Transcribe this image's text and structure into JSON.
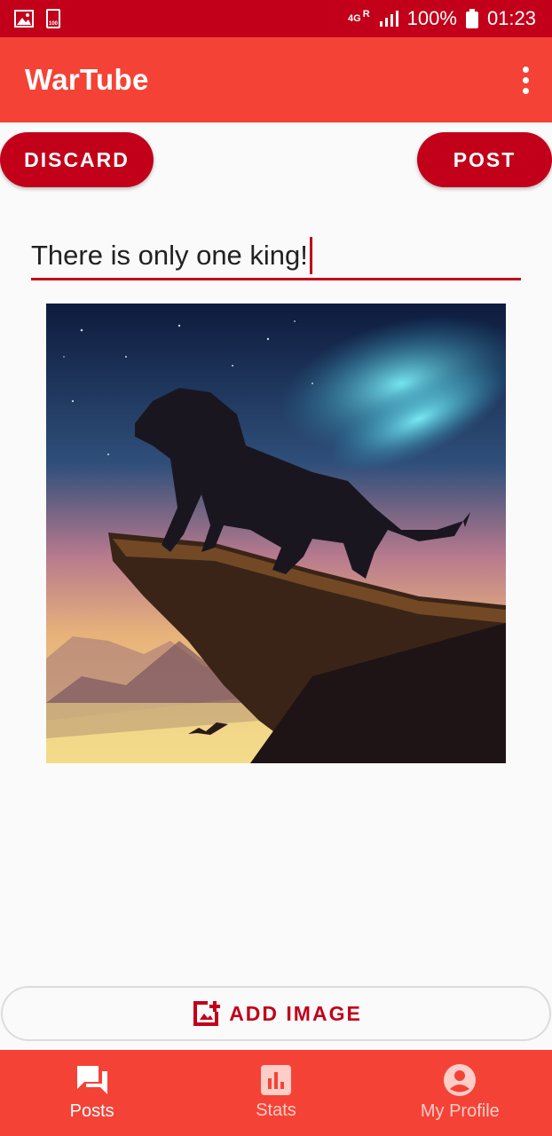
{
  "status_bar": {
    "network": "4G",
    "roaming": "R",
    "battery_percent": "100%",
    "time": "01:23",
    "small_badge": "100"
  },
  "app_bar": {
    "title": "WarTube"
  },
  "actions": {
    "discard_label": "DISCARD",
    "post_label": "POST"
  },
  "composer": {
    "caption": "There is only one king!"
  },
  "add_image_label": "ADD IMAGE",
  "bottom_nav": {
    "items": [
      {
        "label": "Posts",
        "icon": "chat-bubbles-icon",
        "active": true
      },
      {
        "label": "Stats",
        "icon": "bar-chart-icon",
        "active": false
      },
      {
        "label": "My Profile",
        "icon": "account-circle-icon",
        "active": false
      }
    ]
  },
  "colors": {
    "status_bar": "#c2001a",
    "app_bar": "#f44336",
    "accent": "#c2001a",
    "background": "#fafafa"
  }
}
